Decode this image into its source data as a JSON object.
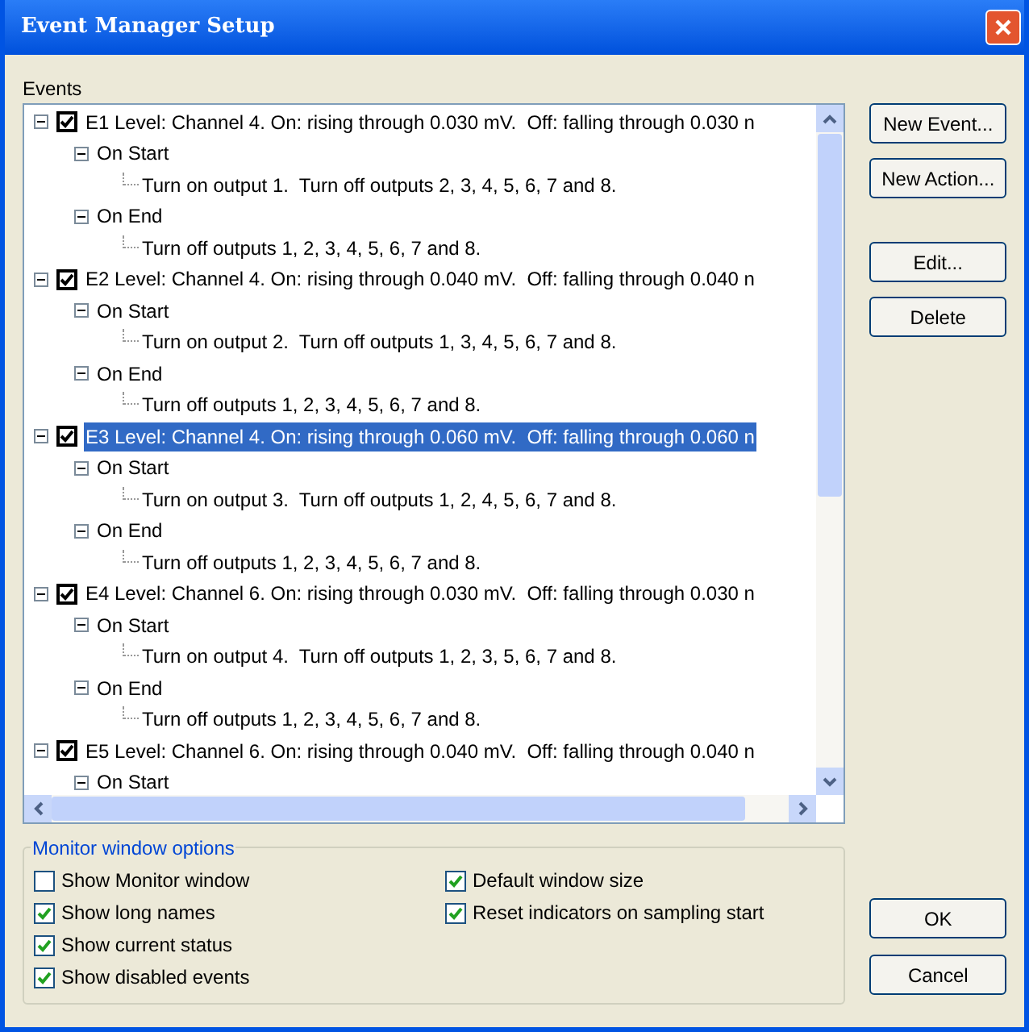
{
  "window": {
    "title": "Event Manager Setup"
  },
  "events_label": "Events",
  "events": [
    {
      "label": "E1 Level: Channel 4. On: rising through 0.030 mV.  Off: falling through 0.030 n",
      "checked": true,
      "selected": false,
      "expanded": true,
      "children": [
        {
          "label": "On Start",
          "expanded": true,
          "children": [
            {
              "label": "Turn on output 1.  Turn off outputs 2, 3, 4, 5, 6, 7 and 8."
            }
          ]
        },
        {
          "label": "On End",
          "expanded": true,
          "children": [
            {
              "label": "Turn off outputs 1, 2, 3, 4, 5, 6, 7 and 8."
            }
          ]
        }
      ]
    },
    {
      "label": "E2 Level: Channel 4. On: rising through 0.040 mV.  Off: falling through 0.040 n",
      "checked": true,
      "selected": false,
      "expanded": true,
      "children": [
        {
          "label": "On Start",
          "expanded": true,
          "children": [
            {
              "label": "Turn on output 2.  Turn off outputs 1, 3, 4, 5, 6, 7 and 8."
            }
          ]
        },
        {
          "label": "On End",
          "expanded": true,
          "children": [
            {
              "label": "Turn off outputs 1, 2, 3, 4, 5, 6, 7 and 8."
            }
          ]
        }
      ]
    },
    {
      "label": "E3 Level: Channel 4. On: rising through 0.060 mV.  Off: falling through 0.060 n",
      "checked": true,
      "selected": true,
      "expanded": true,
      "children": [
        {
          "label": "On Start",
          "expanded": true,
          "children": [
            {
              "label": "Turn on output 3.  Turn off outputs 1, 2, 4, 5, 6, 7 and 8."
            }
          ]
        },
        {
          "label": "On End",
          "expanded": true,
          "children": [
            {
              "label": "Turn off outputs 1, 2, 3, 4, 5, 6, 7 and 8."
            }
          ]
        }
      ]
    },
    {
      "label": "E4 Level: Channel 6. On: rising through 0.030 mV.  Off: falling through 0.030 n",
      "checked": true,
      "selected": false,
      "expanded": true,
      "children": [
        {
          "label": "On Start",
          "expanded": true,
          "children": [
            {
              "label": "Turn on output 4.  Turn off outputs 1, 2, 3, 5, 6, 7 and 8."
            }
          ]
        },
        {
          "label": "On End",
          "expanded": true,
          "children": [
            {
              "label": "Turn off outputs 1, 2, 3, 4, 5, 6, 7 and 8."
            }
          ]
        }
      ]
    },
    {
      "label": "E5 Level: Channel 6. On: rising through 0.040 mV.  Off: falling through 0.040 n",
      "checked": true,
      "selected": false,
      "expanded": true,
      "children": [
        {
          "label": "On Start",
          "expanded": true
        }
      ]
    }
  ],
  "side_buttons": [
    "New Event...",
    "New Action...",
    "Edit...",
    "Delete"
  ],
  "monitor_options": {
    "title": "Monitor window options",
    "column_1": [
      {
        "label": "Show Monitor window",
        "checked": false
      },
      {
        "label": "Show long names",
        "checked": true
      },
      {
        "label": "Show current status",
        "checked": true
      },
      {
        "label": "Show disabled events",
        "checked": true
      }
    ],
    "column_2": [
      {
        "label": "Default window size",
        "checked": true
      },
      {
        "label": "Reset indicators on sampling start",
        "checked": true
      }
    ]
  },
  "dialog_buttons": [
    "OK",
    "Cancel"
  ]
}
